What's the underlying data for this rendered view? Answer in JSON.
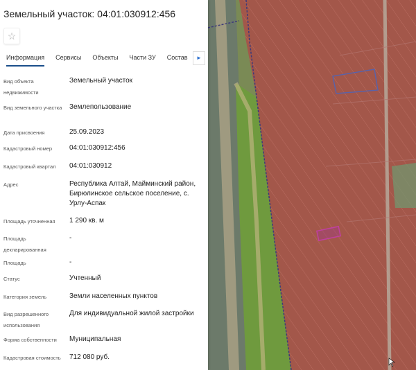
{
  "title": "Земельный участок: 04:01:030912:456",
  "tabs": [
    "Информация",
    "Сервисы",
    "Объекты",
    "Части ЗУ",
    "Состав"
  ],
  "fields": [
    {
      "label": "Вид объекта недвижимости",
      "value": "Земельный участок"
    },
    {
      "label": "Вид земельного участка",
      "value": "Землепользование"
    },
    {
      "label": "Дата присвоения",
      "value": "25.09.2023"
    },
    {
      "label": "Кадастровый номер",
      "value": "04:01:030912:456"
    },
    {
      "label": "Кадастровый квартал",
      "value": "04:01:030912"
    },
    {
      "label": "Адрес",
      "value": "Республика Алтай, Майминский район, Бирюлинское сельское поселение, с. Урлу-Аспак"
    },
    {
      "label": "Площадь уточненная",
      "value": "1 290 кв. м"
    },
    {
      "label": "Площадь декларированная",
      "value": "-"
    },
    {
      "label": "Площадь",
      "value": "-"
    },
    {
      "label": "Статус",
      "value": "Учтенный"
    },
    {
      "label": "Категория земель",
      "value": "Земли населенных пунктов"
    },
    {
      "label": "Вид разрешенного использования",
      "value": "Для индивидуальной жилой застройки"
    },
    {
      "label": "Форма собственности",
      "value": "Муниципальная"
    },
    {
      "label": "Кадастровая стоимость",
      "value": "712 080 руб."
    }
  ],
  "colors": {
    "accent": "#1a4e8a",
    "parcel": "#b0306e",
    "overlay": "#c0504d"
  }
}
